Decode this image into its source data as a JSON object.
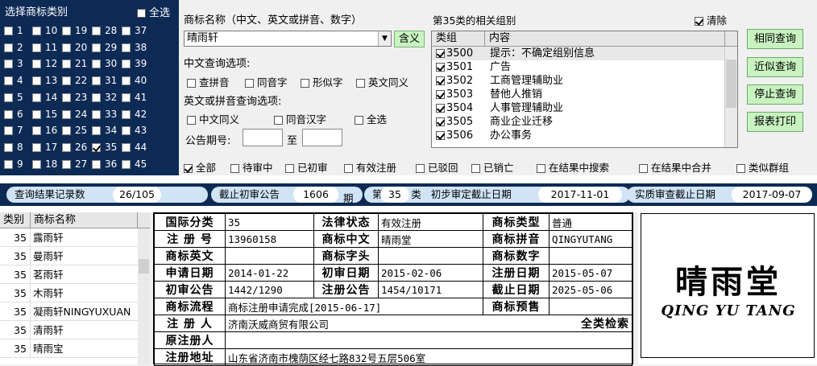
{
  "categories": {
    "title": "选择商标类别",
    "select_all": "全选",
    "items": [
      {
        "n": "1",
        "checked": false
      },
      {
        "n": "2",
        "checked": false
      },
      {
        "n": "3",
        "checked": false
      },
      {
        "n": "4",
        "checked": false
      },
      {
        "n": "5",
        "checked": false
      },
      {
        "n": "6",
        "checked": false
      },
      {
        "n": "7",
        "checked": false
      },
      {
        "n": "8",
        "checked": false
      },
      {
        "n": "9",
        "checked": false
      },
      {
        "n": "10",
        "checked": false
      },
      {
        "n": "11",
        "checked": false
      },
      {
        "n": "12",
        "checked": false
      },
      {
        "n": "13",
        "checked": false
      },
      {
        "n": "14",
        "checked": false
      },
      {
        "n": "15",
        "checked": false
      },
      {
        "n": "16",
        "checked": false
      },
      {
        "n": "17",
        "checked": false
      },
      {
        "n": "18",
        "checked": false
      },
      {
        "n": "19",
        "checked": false
      },
      {
        "n": "20",
        "checked": false
      },
      {
        "n": "21",
        "checked": false
      },
      {
        "n": "22",
        "checked": false
      },
      {
        "n": "23",
        "checked": false
      },
      {
        "n": "24",
        "checked": false
      },
      {
        "n": "25",
        "checked": false
      },
      {
        "n": "26",
        "checked": false
      },
      {
        "n": "27",
        "checked": false
      },
      {
        "n": "28",
        "checked": false
      },
      {
        "n": "29",
        "checked": false
      },
      {
        "n": "30",
        "checked": false
      },
      {
        "n": "31",
        "checked": false
      },
      {
        "n": "32",
        "checked": false
      },
      {
        "n": "33",
        "checked": false
      },
      {
        "n": "34",
        "checked": false
      },
      {
        "n": "35",
        "checked": true
      },
      {
        "n": "36",
        "checked": false
      },
      {
        "n": "37",
        "checked": false
      },
      {
        "n": "38",
        "checked": false
      },
      {
        "n": "39",
        "checked": false
      },
      {
        "n": "40",
        "checked": false
      },
      {
        "n": "41",
        "checked": false
      },
      {
        "n": "42",
        "checked": false
      },
      {
        "n": "43",
        "checked": false
      },
      {
        "n": "44",
        "checked": false
      },
      {
        "n": "45",
        "checked": false
      }
    ]
  },
  "query": {
    "name_label": "商标名称（中文、英文或拼音、数字）",
    "name_value": "晴雨轩",
    "meaning_btn": "含义",
    "cn_options_label": "中文查询选项:",
    "cn_options": [
      "查拼音",
      "同音字",
      "形似字",
      "英文同义"
    ],
    "en_options_label": "英文或拼音查询选项:",
    "en_options": [
      "中文同义",
      "同音汉字",
      "全选"
    ],
    "issue_label": "公告期号:",
    "issue_to": "至"
  },
  "groups": {
    "title": "第35类的相关组别",
    "clear": "清除",
    "col_group": "类组",
    "col_content": "内容",
    "rows": [
      {
        "code": "3500",
        "text": "提示：不确定组别信息"
      },
      {
        "code": "3501",
        "text": "广告"
      },
      {
        "code": "3502",
        "text": "工商管理辅助业"
      },
      {
        "code": "3503",
        "text": "替他人推销"
      },
      {
        "code": "3504",
        "text": "人事管理辅助业"
      },
      {
        "code": "3505",
        "text": "商业企业迁移"
      },
      {
        "code": "3506",
        "text": "办公事务"
      }
    ]
  },
  "buttons": {
    "same": "相同查询",
    "similar": "近似查询",
    "stop": "停止查询",
    "print": "报表打印"
  },
  "filters": [
    {
      "label": "全部",
      "checked": true
    },
    {
      "label": "待审中",
      "checked": false
    },
    {
      "label": "已初审",
      "checked": false
    },
    {
      "label": "有效注册",
      "checked": false
    },
    {
      "label": "已驳回",
      "checked": false
    },
    {
      "label": "已销亡",
      "checked": false
    },
    {
      "label": "在结果中搜索",
      "checked": false
    },
    {
      "label": "在结果中合并",
      "checked": false
    },
    {
      "label": "类似群组",
      "checked": false
    }
  ],
  "status": {
    "records_label": "查询结果记录数",
    "records_value": "26/105",
    "cutoff_label": "截止初审公告",
    "cutoff_value": "1606",
    "cutoff_unit": "期",
    "class_prefix": "第",
    "class_value": "35",
    "class_suffix": "类",
    "prelim_label": "初步审定截止日期",
    "prelim_value": "2017-11-01",
    "exam_label": "实质审查截止日期",
    "exam_value": "2017-09-07"
  },
  "results": {
    "col_class": "类别",
    "col_name": "商标名称",
    "rows": [
      {
        "c": "35",
        "name": "露雨轩"
      },
      {
        "c": "35",
        "name": "曼雨轩"
      },
      {
        "c": "35",
        "name": "茗雨轩"
      },
      {
        "c": "35",
        "name": "木雨轩"
      },
      {
        "c": "35",
        "name": "凝雨轩NINGYUXUAN"
      },
      {
        "c": "35",
        "name": "清雨轩"
      },
      {
        "c": "35",
        "name": "晴雨宝"
      }
    ]
  },
  "detail": {
    "k_class": "国际分类",
    "v_class": "35",
    "k_legal": "法律状态",
    "v_legal": "有效注册",
    "k_type": "商标类型",
    "v_type": "普通",
    "k_regno": "注 册 号",
    "v_regno": "13960158",
    "k_cn": "商标中文",
    "v_cn": "晴雨堂",
    "k_py": "商标拼音",
    "v_py": "QINGYUTANG",
    "k_en": "商标英文",
    "v_en": "",
    "k_head": "商标字头",
    "v_head": "",
    "k_num": "商标数字",
    "v_num": "",
    "k_apply": "申请日期",
    "v_apply": "2014-01-22",
    "k_first": "初审日期",
    "v_first": "2015-02-06",
    "k_regdate": "注册日期",
    "v_regdate": "2015-05-07",
    "k_fpub": "初审公告",
    "v_fpub": "1442/1290",
    "k_rpub": "注册公告",
    "v_rpub": "1454/10171",
    "k_end": "截止日期",
    "v_end": "2025-05-06",
    "k_flow": "商标流程",
    "v_flow": "商标注册申请完成[2015-06-17]",
    "k_pre": "商标预售",
    "v_pre": "",
    "k_reg": "注 册 人",
    "v_reg": "济南沃威商贸有限公司",
    "search_all": "全类检索",
    "k_orig": "原注册人",
    "v_orig": "",
    "k_addr": "注册地址",
    "v_addr": "山东省济南市槐荫区经七路832号五层506室"
  },
  "logo": {
    "cn": "晴雨堂",
    "en": "QING YU TANG"
  }
}
